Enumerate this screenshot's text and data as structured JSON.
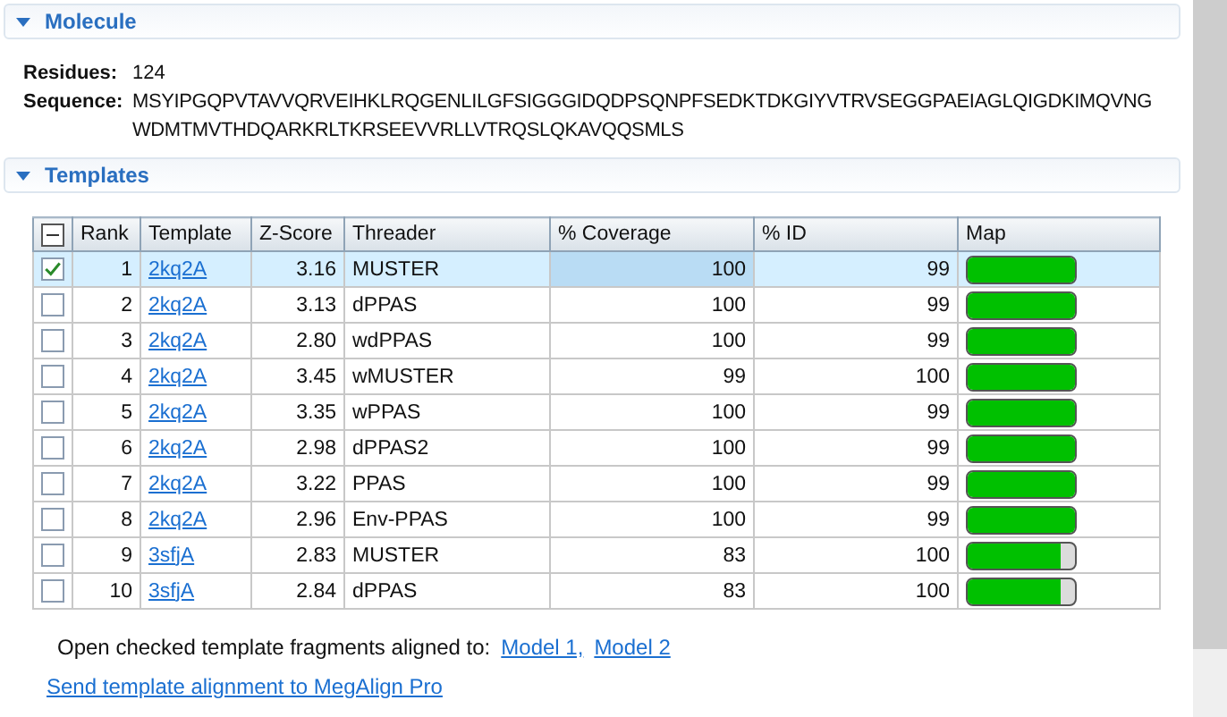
{
  "sections": [
    {
      "title": "Molecule",
      "expanded": true
    },
    {
      "title": "Templates",
      "expanded": true
    }
  ],
  "molecule": {
    "residues_label": "Residues:",
    "residues": "124",
    "sequence_label": "Sequence:",
    "sequence": "MSYIPGQPVTAVVQRVEIHKLRQGENLILGFSIGGGIDQDPSQNPFSEDKTDKGIYVTRVSEGGPAEIAGLQIGDKIMQVNGWDMTMVTHDQARKRLTKRSEEVVRLLVTRQSLQKAVQQSMLS"
  },
  "table": {
    "header_mixed": true,
    "columns": [
      "Rank",
      "Template",
      "Z-Score",
      "Threader",
      "% Coverage",
      "% ID",
      "Map"
    ],
    "rows": [
      {
        "checked": true,
        "selected": true,
        "cells": [
          "1",
          "2kq2A",
          "3.16",
          "MUSTER",
          "100",
          "99"
        ],
        "level": 1
      },
      {
        "checked": false,
        "selected": false,
        "cells": [
          "2",
          "2kq2A",
          "3.13",
          "dPPAS",
          "100",
          "99"
        ],
        "level": 1
      },
      {
        "checked": false,
        "selected": false,
        "cells": [
          "3",
          "2kq2A",
          "2.80",
          "wdPPAS",
          "100",
          "99"
        ],
        "level": 1
      },
      {
        "checked": false,
        "selected": false,
        "cells": [
          "4",
          "2kq2A",
          "3.45",
          "wMUSTER",
          "99",
          "100"
        ],
        "level": 1
      },
      {
        "checked": false,
        "selected": false,
        "cells": [
          "5",
          "2kq2A",
          "3.35",
          "wPPAS",
          "100",
          "99"
        ],
        "level": 1
      },
      {
        "checked": false,
        "selected": false,
        "cells": [
          "6",
          "2kq2A",
          "2.98",
          "dPPAS2",
          "100",
          "99"
        ],
        "level": 1
      },
      {
        "checked": false,
        "selected": false,
        "cells": [
          "7",
          "2kq2A",
          "3.22",
          "PPAS",
          "100",
          "99"
        ],
        "level": 1
      },
      {
        "checked": false,
        "selected": false,
        "cells": [
          "8",
          "2kq2A",
          "2.96",
          "Env-PPAS",
          "100",
          "99"
        ],
        "level": 1
      },
      {
        "checked": false,
        "selected": false,
        "cells": [
          "9",
          "3sfjA",
          "2.83",
          "MUSTER",
          "83",
          "100"
        ],
        "level": 0.86
      },
      {
        "checked": false,
        "selected": false,
        "cells": [
          "10",
          "3sfjA",
          "2.84",
          "dPPAS",
          "83",
          "100"
        ],
        "level": 0.86
      }
    ]
  },
  "open_fragments": {
    "label": "Open checked template fragments aligned to:",
    "links": [
      "Model 1,",
      "Model 2"
    ]
  },
  "send_link": "Send template alignment to MegAlign Pro"
}
